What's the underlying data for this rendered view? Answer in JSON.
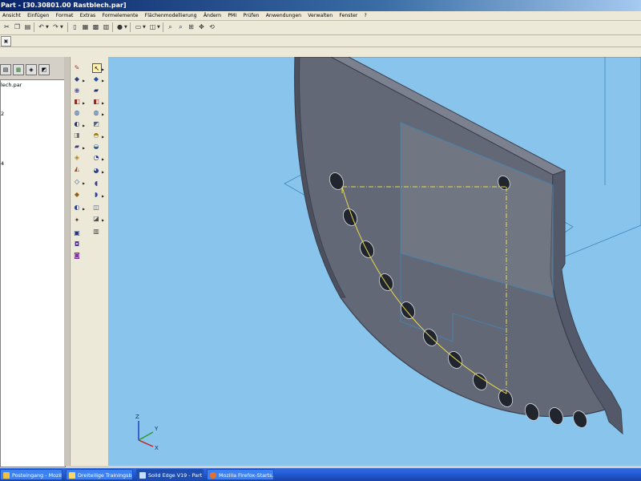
{
  "window": {
    "title": "Part - [30.30801.00 Rastblech.par]"
  },
  "menu": [
    "Ansicht",
    "Einfügen",
    "Format",
    "Extras",
    "Formelemente",
    "Flächenmodellierung",
    "Ändern",
    "PMI",
    "Prüfen",
    "Anwendungen",
    "Verwalten",
    "Fenster",
    "?"
  ],
  "pathfinder": {
    "items": [
      {
        "label": "lech.par"
      },
      {
        "label": "2"
      },
      {
        "label": "4"
      }
    ]
  },
  "taskbar": {
    "items": [
      {
        "label": "Posteingang - Mozilla ...",
        "icon": "mail-icon",
        "active": false
      },
      {
        "label": "Dreiteilige Trainingsbank",
        "icon": "folder-icon",
        "active": false
      },
      {
        "label": "Solid Edge V19 - Part ...",
        "icon": "solid-edge-icon",
        "active": true
      },
      {
        "label": "Mozilla Firefox-Starts...",
        "icon": "firefox-icon",
        "active": false
      }
    ]
  },
  "triad": {
    "z": "Z",
    "y": "Y",
    "x": "X"
  },
  "colors": {
    "viewport_bg": "#88c4ec",
    "part_face": "#636876",
    "part_edge": "#3c404e",
    "sketch_line": "#e8d84c",
    "titlebar": "#0a246a",
    "taskbar": "#245edb"
  }
}
